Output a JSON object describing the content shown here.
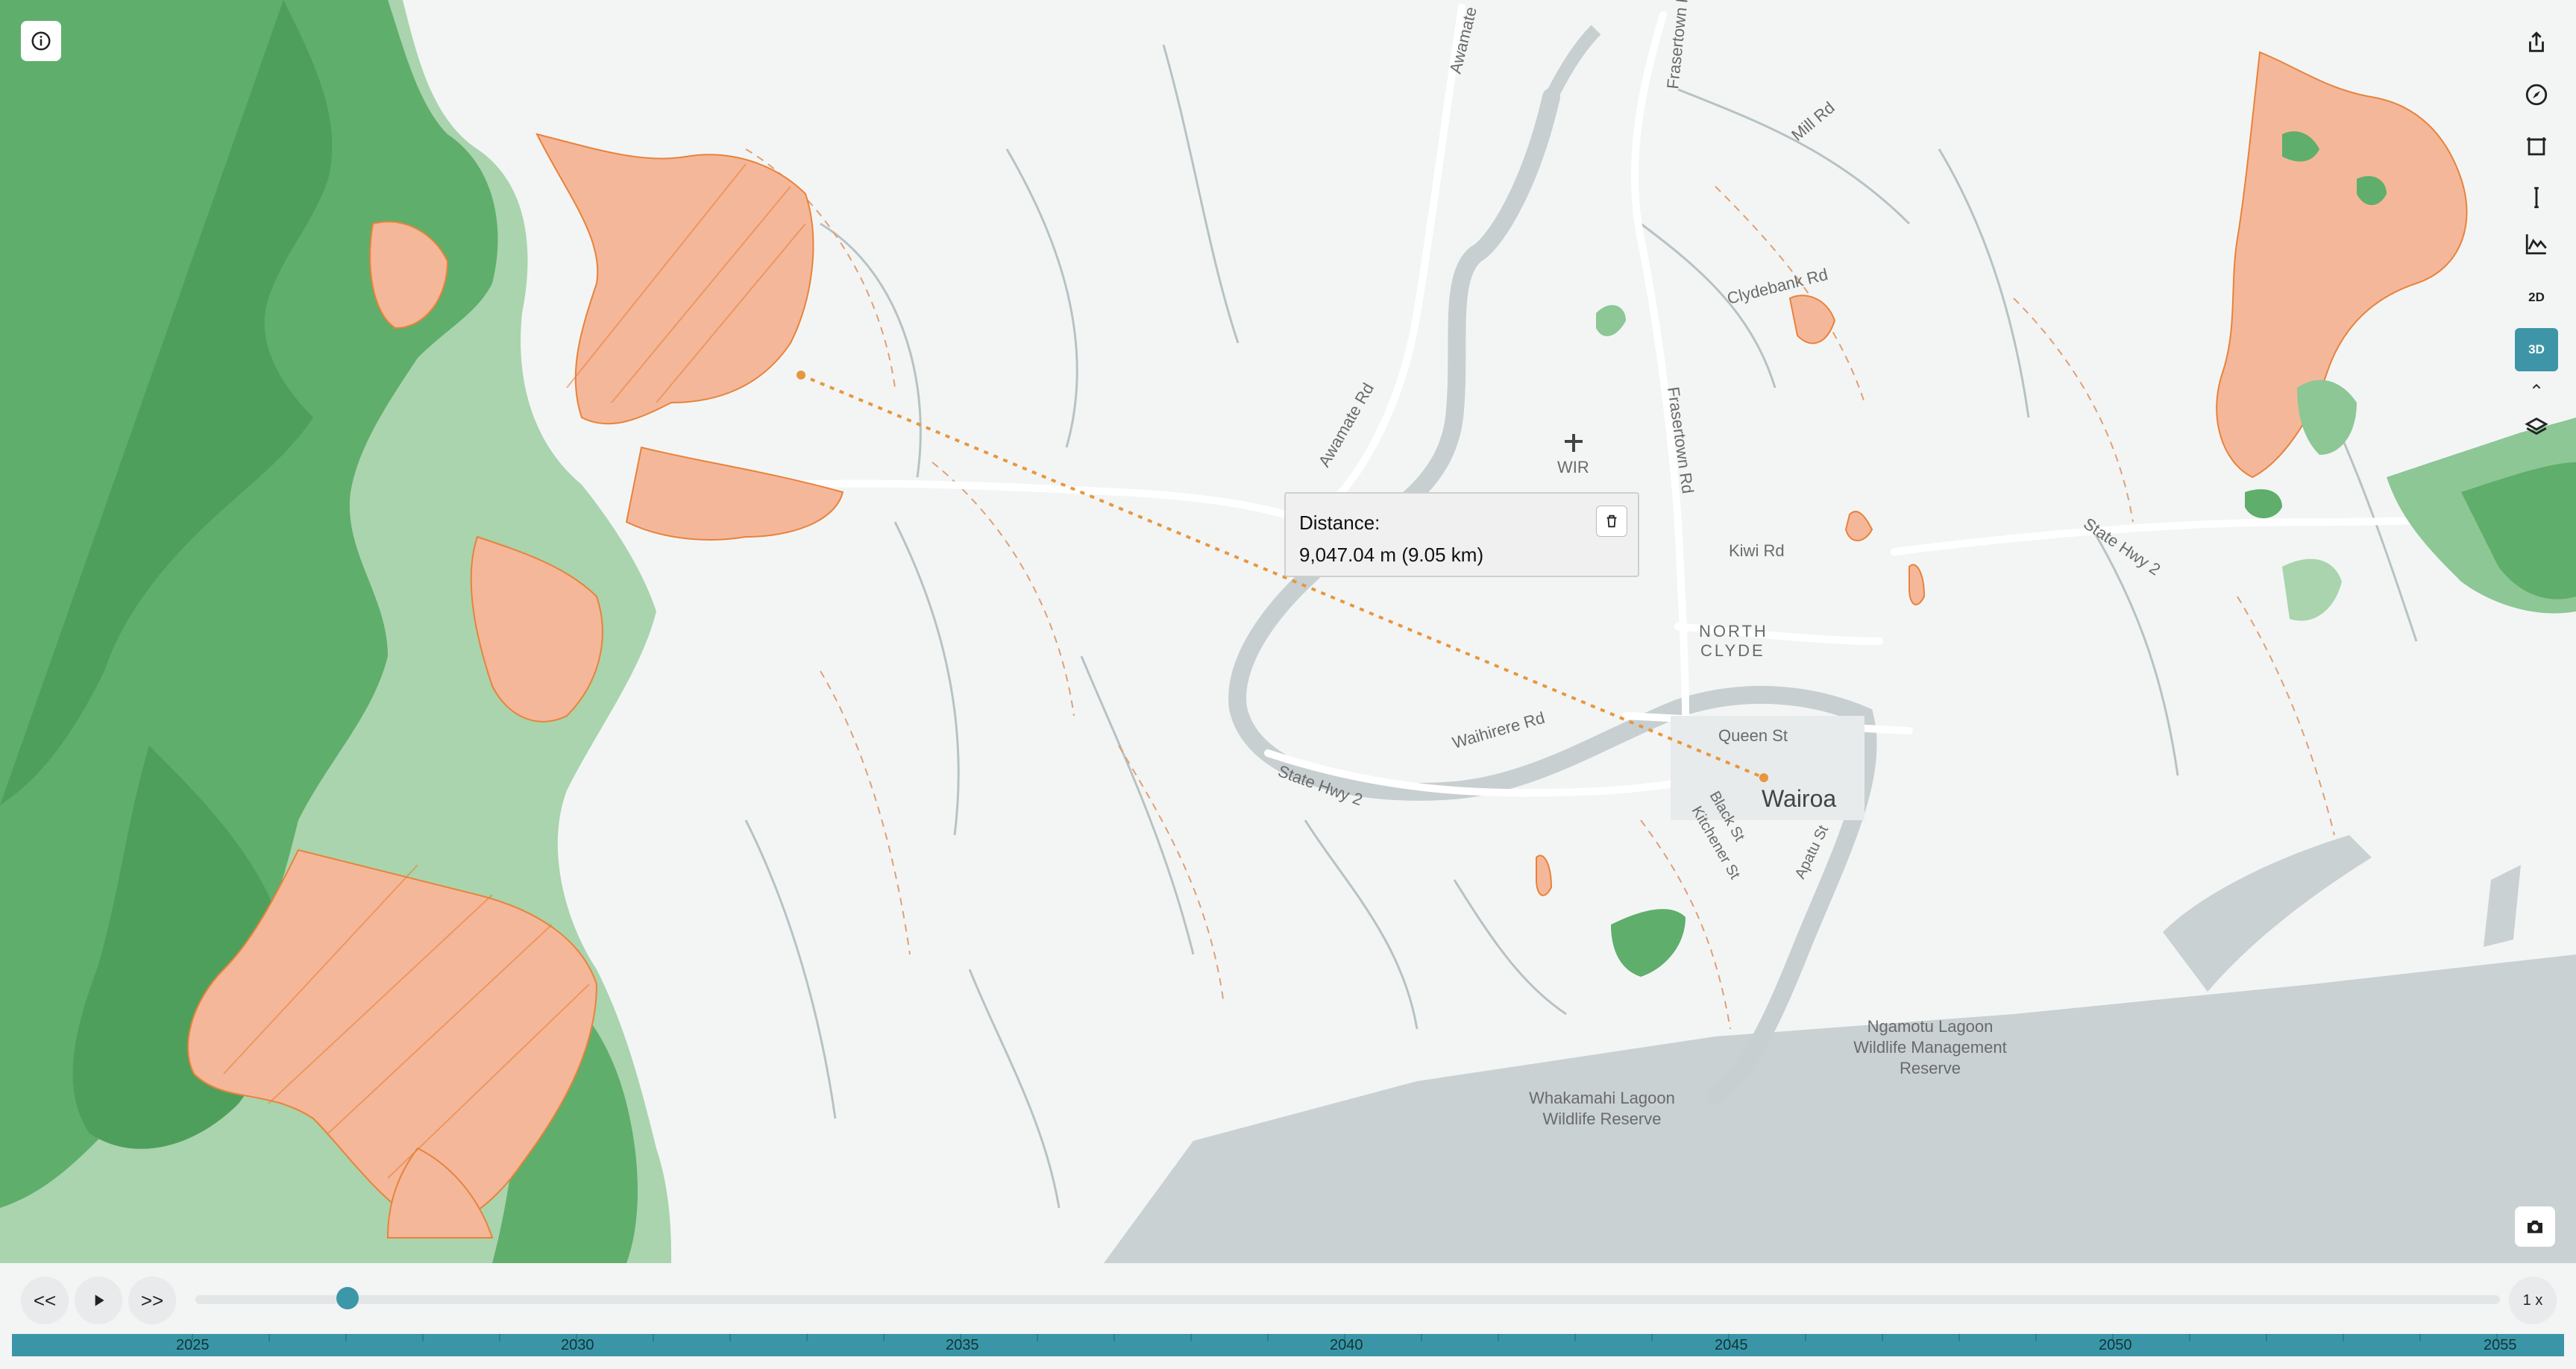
{
  "map": {
    "town_label": "Wairoa",
    "suburb_label_line1": "NORTH",
    "suburb_label_line2": "CLYDE",
    "airport_code": "WIR",
    "roads": [
      {
        "name": "Awamate"
      },
      {
        "name": "Frasertown Rd"
      },
      {
        "name": "Mill Rd"
      },
      {
        "name": "Clydebank Rd"
      },
      {
        "name": "Awamate Rd"
      },
      {
        "name": "Kiwi Rd"
      },
      {
        "name": "State Hwy 2"
      },
      {
        "name": "Waihirere Rd"
      },
      {
        "name": "Queen St"
      },
      {
        "name": "State Hwy 2"
      },
      {
        "name": "Black St"
      },
      {
        "name": "Kitchener St"
      },
      {
        "name": "Apatu St"
      }
    ],
    "reserves": [
      {
        "line1": "Ngamotu Lagoon",
        "line2": "Wildlife Management",
        "line3": "Reserve"
      },
      {
        "line1": "Whakamahi Lagoon",
        "line2": "Wildlife Reserve"
      }
    ],
    "colors": {
      "land": "#f3f5f5",
      "forest": "#5fae6b",
      "forest_light": "#a9d5ae",
      "highlight": "#f4b48f",
      "highlight_stroke": "#e8833a",
      "water": "#c8d0d2",
      "measure_line": "#e8963e",
      "accent": "#3c97a8"
    }
  },
  "measure": {
    "label": "Distance:",
    "value": "9,047.04 m (9.05 km)",
    "delete_icon": "trash-icon"
  },
  "controls": {
    "info_icon": "info-icon",
    "right": [
      {
        "icon": "share-icon"
      },
      {
        "icon": "compass-icon"
      },
      {
        "icon": "area-measure-icon"
      },
      {
        "icon": "ruler-icon"
      },
      {
        "icon": "elevation-profile-icon"
      },
      {
        "icon": "2d-view-icon",
        "label": "2D"
      },
      {
        "icon": "3d-view-icon",
        "label": "3D",
        "active": true
      },
      {
        "icon": "layers-icon"
      }
    ],
    "camera_icon": "camera-icon"
  },
  "timeline": {
    "rewind_label": "<<",
    "forward_label": ">>",
    "speed": "1 x",
    "position_year": 2027,
    "years": [
      "2025",
      "2030",
      "2035",
      "2040",
      "2045",
      "2050",
      "2055"
    ]
  }
}
